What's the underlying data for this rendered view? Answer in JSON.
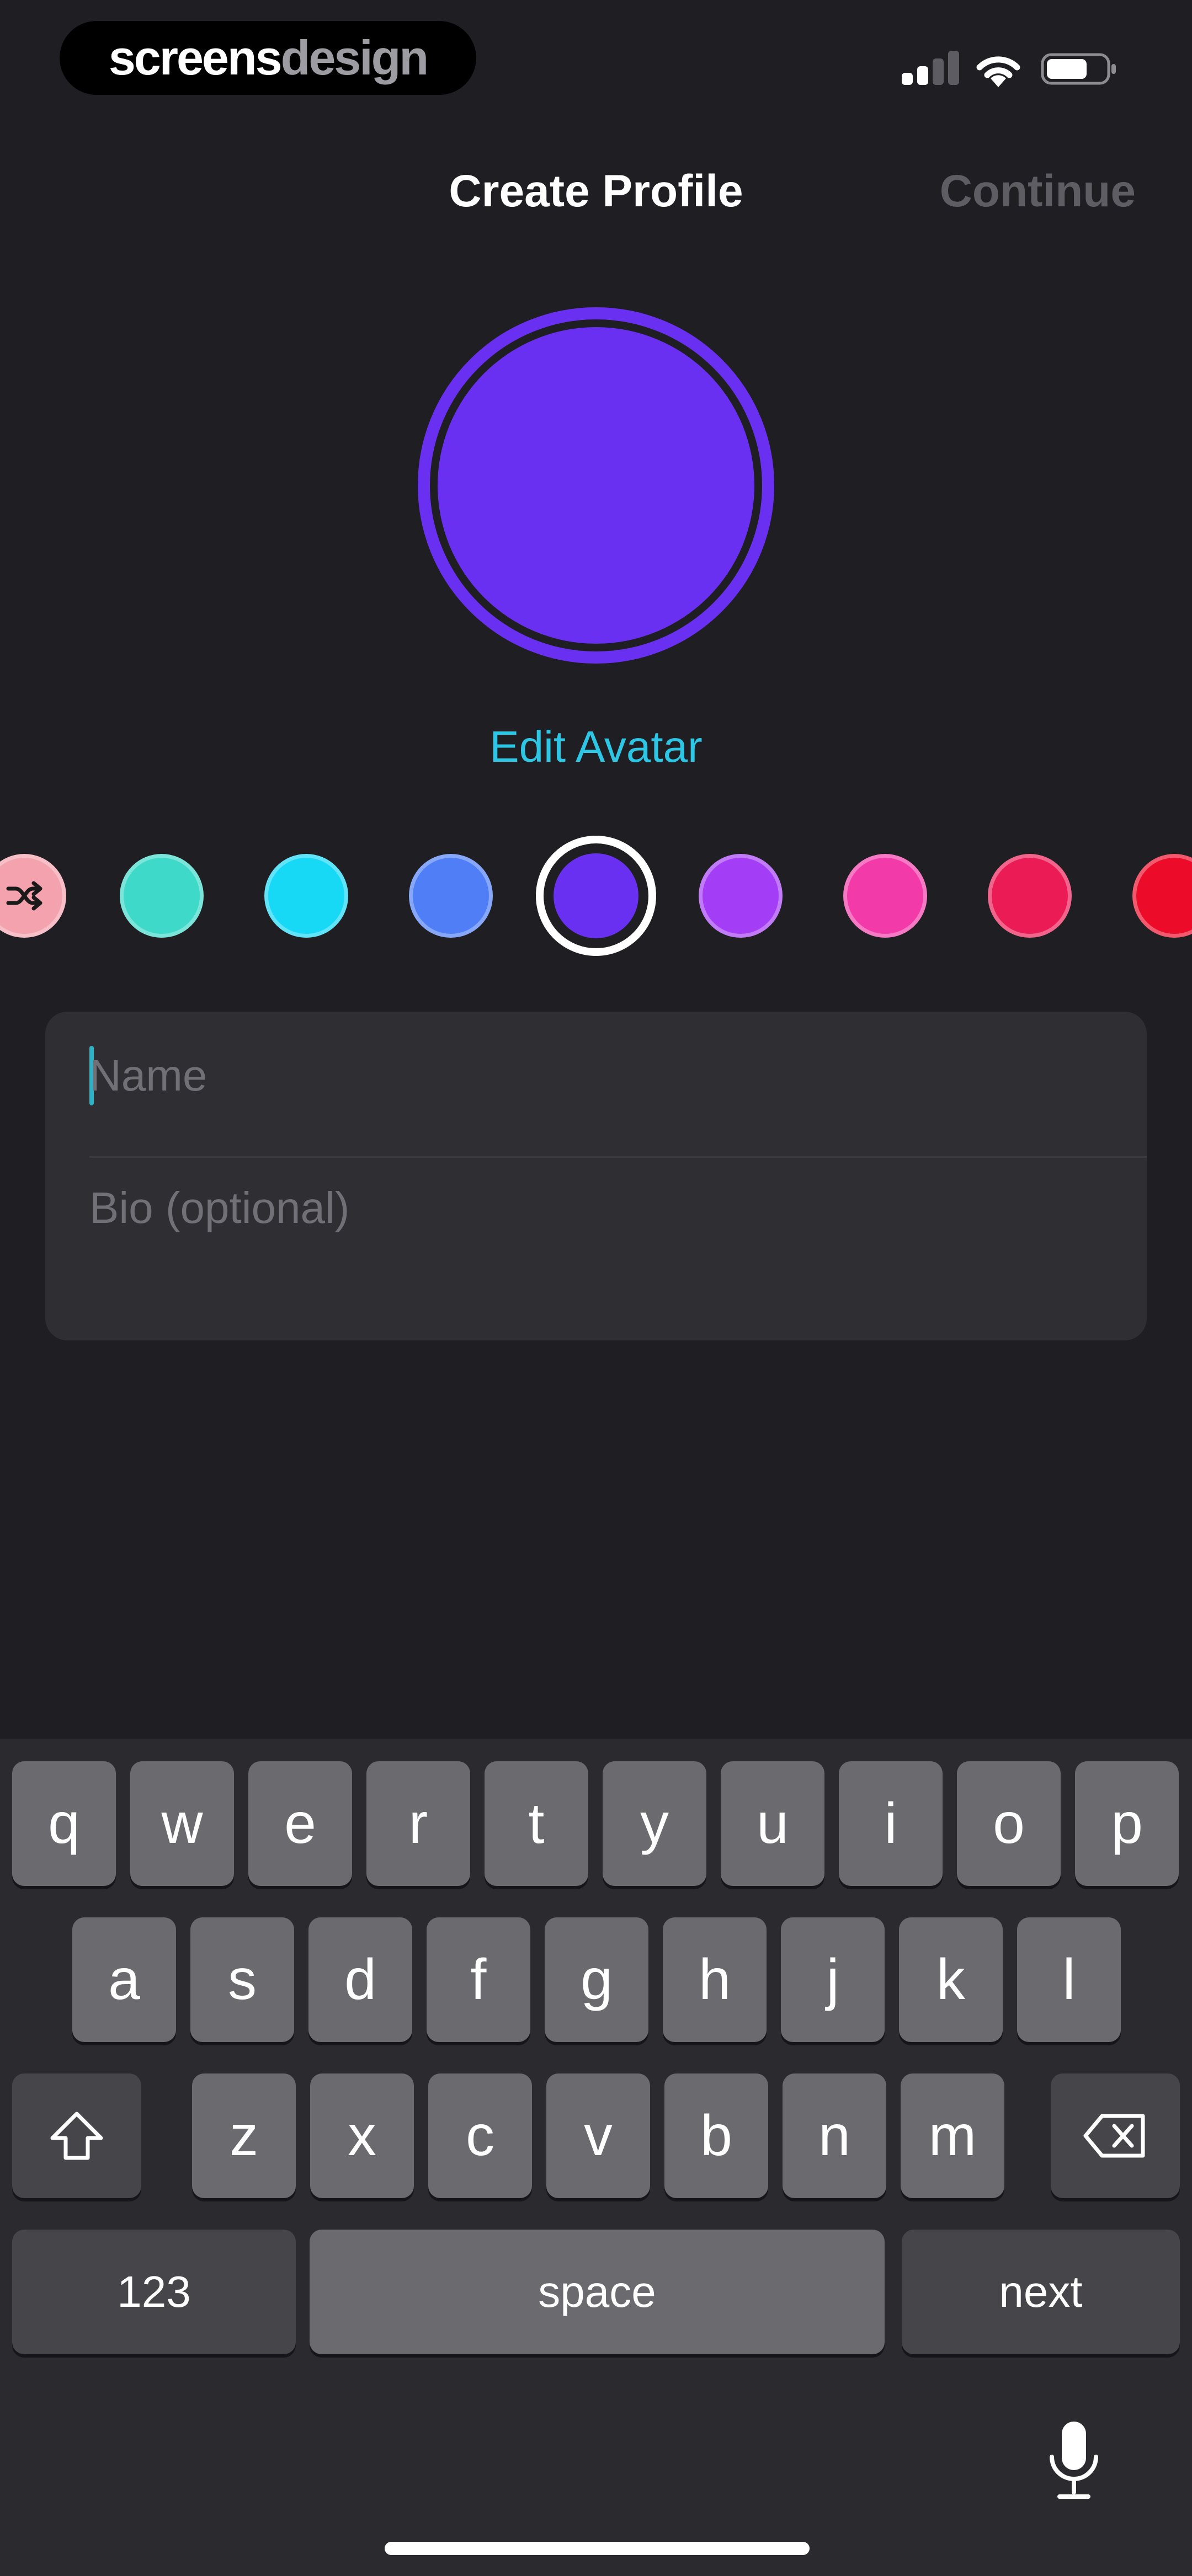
{
  "status_bar": {
    "brand_part1": "screens",
    "brand_part2": "design",
    "icons": [
      "cellular-signal-icon",
      "wifi-icon",
      "battery-icon"
    ]
  },
  "nav": {
    "title": "Create Profile",
    "continue_label": "Continue"
  },
  "avatar": {
    "color": "#6a30f2",
    "edit_label": "Edit Avatar"
  },
  "swatches": {
    "shuffle_icon": "shuffle-icon",
    "colors": [
      "#f3a2ae",
      "#3ed9c8",
      "#17d8f5",
      "#4f7ef6",
      "#6a30f2",
      "#a43df6",
      "#f23aa9",
      "#eb1b55",
      "#ec0b28"
    ],
    "selected_index": 4
  },
  "form": {
    "name_placeholder": "Name",
    "bio_placeholder": "Bio (optional)"
  },
  "keyboard": {
    "row1": [
      "q",
      "w",
      "e",
      "r",
      "t",
      "y",
      "u",
      "i",
      "o",
      "p"
    ],
    "row2": [
      "a",
      "s",
      "d",
      "f",
      "g",
      "h",
      "j",
      "k",
      "l"
    ],
    "row3": [
      "z",
      "x",
      "c",
      "v",
      "b",
      "n",
      "m"
    ],
    "numbers_label": "123",
    "space_label": "space",
    "next_label": "next",
    "icons": [
      "shift-icon",
      "delete-icon",
      "microphone-icon"
    ]
  },
  "colors": {
    "background": "#1f1e22",
    "accent_text": "#2dc6e4",
    "disabled_text": "#5e5d63"
  }
}
